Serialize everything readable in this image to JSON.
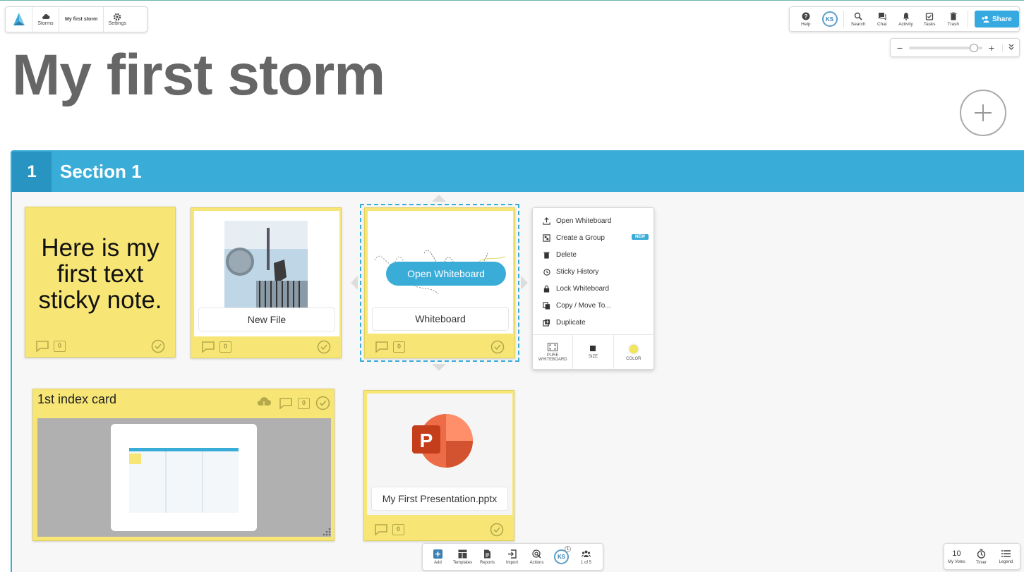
{
  "topbar": {
    "storms_label": "Storms",
    "storm_name": "My first storm",
    "settings_label": "Settings",
    "help_label": "Help",
    "avatar_initials": "KS",
    "search_label": "Search",
    "chat_label": "Chat",
    "activity_label": "Activity",
    "tasks_label": "Tasks",
    "trash_label": "Trash",
    "share_label": "Share"
  },
  "zoom": {
    "minus": "−",
    "plus": "+",
    "level_fraction": 0.88
  },
  "title": "My first storm",
  "section": {
    "number": "1",
    "name": "Section 1"
  },
  "notes": {
    "text_note": {
      "text": "Here is my first text sticky note.",
      "comments": "0"
    },
    "file_note": {
      "caption": "New File",
      "comments": "0"
    },
    "whiteboard_note": {
      "caption": "Whiteboard",
      "button": "Open Whiteboard",
      "comments": "0"
    },
    "index_card": {
      "title": "1st index card",
      "comments": "0"
    },
    "pptx_note": {
      "caption": "My First Presentation.pptx",
      "comments": "0"
    }
  },
  "context_menu": {
    "items": [
      "Open Whiteboard",
      "Create a Group",
      "Delete",
      "Sticky History",
      "Lock Whiteboard",
      "Copy / Move To...",
      "Duplicate"
    ],
    "new_badge": "NEW",
    "options": [
      "PURE WHITEBOARD",
      "SIZE",
      "COLOR"
    ]
  },
  "bottom_bar": {
    "add": "Add",
    "templates": "Templates",
    "reports": "Reports",
    "import": "Import",
    "actions": "Actions",
    "avatar_initials": "KS",
    "avatar_badge": "1",
    "participants": "1 of 5"
  },
  "bottom_right": {
    "votes_count": "10",
    "votes_label": "My Votes",
    "timer_label": "Timer",
    "legend_label": "Legend"
  },
  "colors": {
    "accent": "#3aacd8",
    "sticky": "#f7e676",
    "share": "#36a9e1"
  }
}
